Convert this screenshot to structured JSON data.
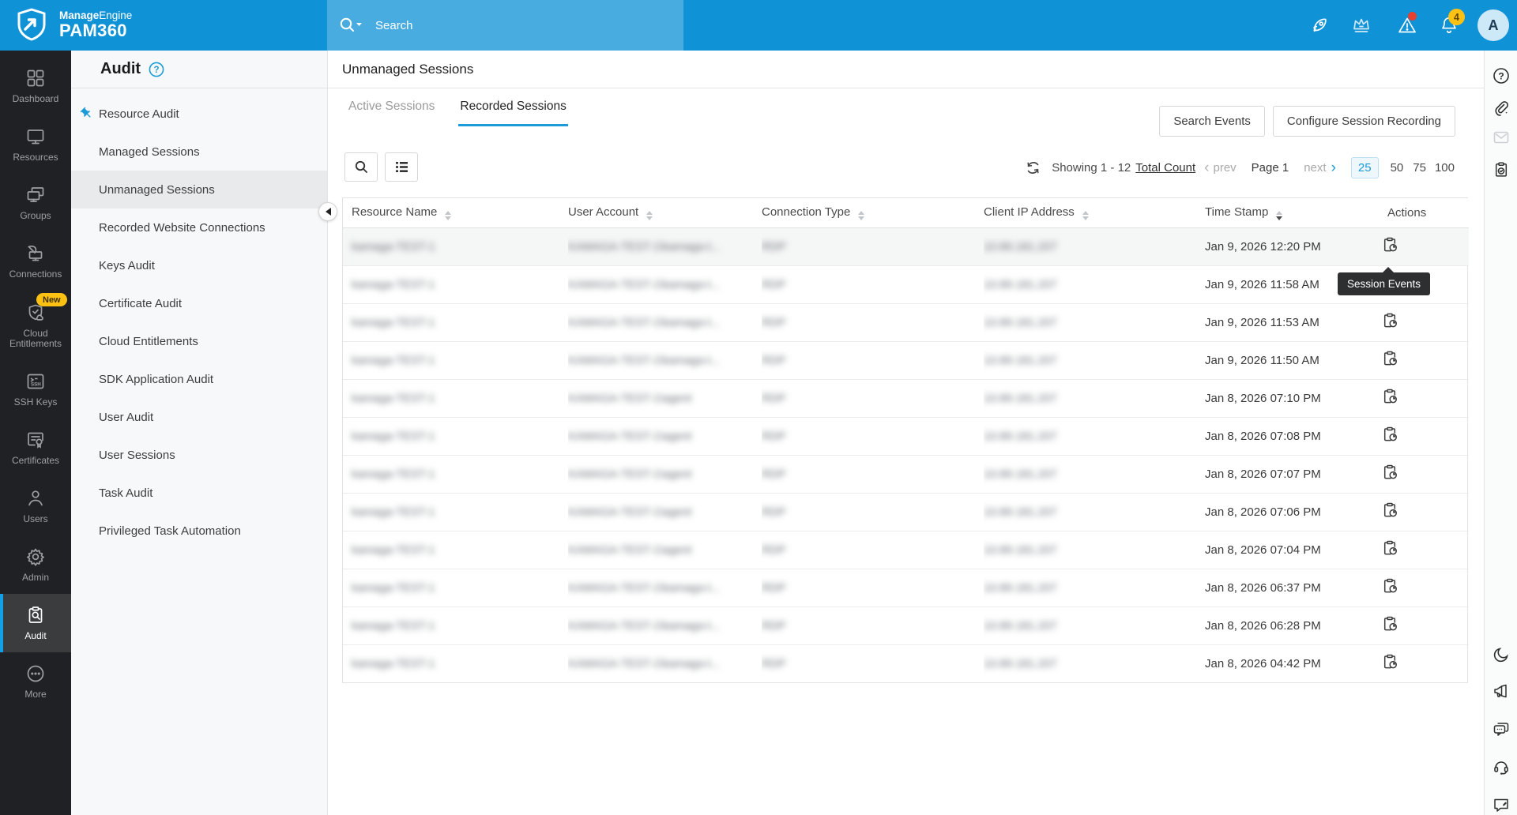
{
  "topbar": {
    "brand_bold": "Manage",
    "brand_light": "Engine",
    "product": "PAM360",
    "search_placeholder": "Search",
    "alerts_badge": "4",
    "avatar_letter": "A"
  },
  "colors": {
    "topbar_blue": "#1092d6",
    "accent_blue": "#1b9bd7",
    "sidebar_dark": "#202124",
    "badge_yellow": "#fdc113",
    "alert_red": "#e8402e"
  },
  "sidebar": {
    "items": [
      {
        "label": "Dashboard",
        "icon": "dashboard-icon"
      },
      {
        "label": "Resources",
        "icon": "resources-icon"
      },
      {
        "label": "Groups",
        "icon": "groups-icon"
      },
      {
        "label": "Connections",
        "icon": "connections-icon"
      },
      {
        "label": "Cloud Entitlements",
        "icon": "cloud-entitlements-icon",
        "badge": "New"
      },
      {
        "label": "SSH Keys",
        "icon": "ssh-keys-icon"
      },
      {
        "label": "Certificates",
        "icon": "certificates-icon"
      },
      {
        "label": "Users",
        "icon": "users-icon"
      },
      {
        "label": "Admin",
        "icon": "admin-icon"
      },
      {
        "label": "Audit",
        "icon": "audit-icon",
        "active": true
      },
      {
        "label": "More",
        "icon": "more-icon"
      }
    ]
  },
  "audit_menu": {
    "title": "Audit",
    "items": [
      "Resource Audit",
      "Managed Sessions",
      "Unmanaged Sessions",
      "Recorded Website Connections",
      "Keys Audit",
      "Certificate Audit",
      "Cloud Entitlements",
      "SDK Application Audit",
      "User Audit",
      "User Sessions",
      "Task Audit",
      "Privileged Task Automation"
    ],
    "selected": "Unmanaged Sessions"
  },
  "main": {
    "title": "Unmanaged Sessions",
    "tabs": [
      {
        "label": "Active Sessions",
        "active": false
      },
      {
        "label": "Recorded Sessions",
        "active": true
      }
    ],
    "buttons": {
      "search_events": "Search Events",
      "configure_session_recording": "Configure Session Recording"
    },
    "pagination": {
      "showing": "Showing 1 - 12",
      "total_count_link": "Total Count",
      "prev_chevron": "‹",
      "prev": "prev",
      "page": "Page 1",
      "next": "next",
      "next_chevron": "›",
      "page_sizes": [
        "25",
        "50",
        "75",
        "100"
      ],
      "selected_size": "25"
    },
    "table": {
      "columns": [
        "Resource Name",
        "User Account",
        "Connection Type",
        "Client IP Address",
        "Time Stamp",
        "Actions"
      ],
      "sorted_column": "Time Stamp",
      "rows": [
        {
          "resource": "kamaga-TEST-1",
          "user": "KAMAGA-TEST-1\\kamaga-t...",
          "conn": "RDP",
          "ip": "10.89.181.207",
          "time": "Jan 9, 2026 12:20 PM"
        },
        {
          "resource": "kamaga-TEST-1",
          "user": "KAMAGA-TEST-1\\kamaga-t...",
          "conn": "RDP",
          "ip": "10.89.181.207",
          "time": "Jan 9, 2026 11:58 AM"
        },
        {
          "resource": "kamaga-TEST-1",
          "user": "KAMAGA-TEST-1\\kamaga-t...",
          "conn": "RDP",
          "ip": "10.89.181.207",
          "time": "Jan 9, 2026 11:53 AM"
        },
        {
          "resource": "kamaga-TEST-1",
          "user": "KAMAGA-TEST-1\\kamaga-t...",
          "conn": "RDP",
          "ip": "10.89.181.207",
          "time": "Jan 9, 2026 11:50 AM"
        },
        {
          "resource": "kamaga-TEST-1",
          "user": "KAMAGA-TEST-1\\agent",
          "conn": "RDP",
          "ip": "10.89.181.207",
          "time": "Jan 8, 2026 07:10 PM"
        },
        {
          "resource": "kamaga-TEST-1",
          "user": "KAMAGA-TEST-1\\agent",
          "conn": "RDP",
          "ip": "10.89.181.207",
          "time": "Jan 8, 2026 07:08 PM"
        },
        {
          "resource": "kamaga-TEST-1",
          "user": "KAMAGA-TEST-1\\agent",
          "conn": "RDP",
          "ip": "10.89.181.207",
          "time": "Jan 8, 2026 07:07 PM"
        },
        {
          "resource": "kamaga-TEST-1",
          "user": "KAMAGA-TEST-1\\agent",
          "conn": "RDP",
          "ip": "10.89.181.207",
          "time": "Jan 8, 2026 07:06 PM"
        },
        {
          "resource": "kamaga-TEST-1",
          "user": "KAMAGA-TEST-1\\agent",
          "conn": "RDP",
          "ip": "10.89.181.207",
          "time": "Jan 8, 2026 07:04 PM"
        },
        {
          "resource": "kamaga-TEST-1",
          "user": "KAMAGA-TEST-1\\kamaga-t...",
          "conn": "RDP",
          "ip": "10.89.181.207",
          "time": "Jan 8, 2026 06:37 PM"
        },
        {
          "resource": "kamaga-TEST-1",
          "user": "KAMAGA-TEST-1\\kamaga-t...",
          "conn": "RDP",
          "ip": "10.89.181.207",
          "time": "Jan 8, 2026 06:28 PM"
        },
        {
          "resource": "kamaga-TEST-1",
          "user": "KAMAGA-TEST-1\\kamaga-t...",
          "conn": "RDP",
          "ip": "10.89.181.207",
          "time": "Jan 8, 2026 04:42 PM"
        }
      ]
    },
    "tooltip": "Session Events"
  },
  "rightbar": {
    "icons_top": [
      "help",
      "attachments",
      "mail",
      "session-audit"
    ],
    "icons_bottom": [
      "dark-mode",
      "announcements",
      "chat",
      "support",
      "feedback"
    ]
  }
}
